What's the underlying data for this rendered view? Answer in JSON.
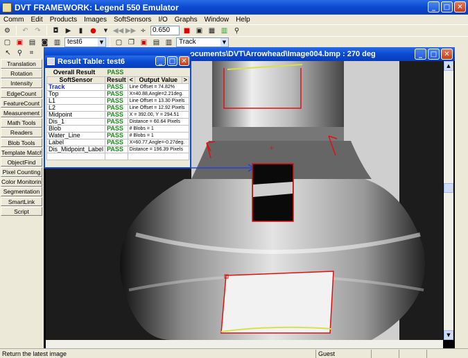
{
  "app": {
    "title": "DVT FRAMEWORK: Legend 550 Emulator"
  },
  "menu": [
    "Comm",
    "Edit",
    "Products",
    "Images",
    "SoftSensors",
    "I/O",
    "Graphs",
    "Window",
    "Help"
  ],
  "toolbar": {
    "threshold_value": "0.650",
    "product_select": "test6",
    "sensor_select": "Track"
  },
  "sidebar": {
    "buttons": [
      "Translation",
      "Rotation",
      "Intensity",
      "EdgeCount",
      "FeatureCount",
      "Measurement",
      "Math Tools",
      "Readers",
      "Blob Tools",
      "Template Match",
      "ObjectFind",
      "Pixel Counting",
      "Color Monitoring",
      "Segmentation",
      "SmartLink",
      "Script"
    ]
  },
  "image_window": {
    "title": "ocuments\\DVT\\Arrowhead\\Image004.bmp : 270 deg"
  },
  "result_table": {
    "title": "Result Table: test6",
    "overall_label": "Overall Result",
    "overall_value": "PASS",
    "col_sensor": "SoftSensor",
    "col_result": "Result",
    "col_prev": "<",
    "col_output": "Output Value",
    "col_next": ">",
    "rows": [
      {
        "name": "Track",
        "result": "PASS",
        "output": "Line Offset = 74.82%"
      },
      {
        "name": "Top",
        "result": "PASS",
        "output": "X=40.88,Angle=2.21deg."
      },
      {
        "name": "L1",
        "result": "PASS",
        "output": "Line Offset = 13.30 Pixels"
      },
      {
        "name": "L2",
        "result": "PASS",
        "output": "Line Offset = 12.92 Pixels"
      },
      {
        "name": "Midpoint",
        "result": "PASS",
        "output": "X = 392.00, Y = 294.51"
      },
      {
        "name": "Dis_1",
        "result": "PASS",
        "output": "Distance = 60.64 Pixels"
      },
      {
        "name": "Blob",
        "result": "PASS",
        "output": "# Blobs = 1"
      },
      {
        "name": "Water_Line",
        "result": "PASS",
        "output": "# Blobs = 1"
      },
      {
        "name": "Label",
        "result": "PASS",
        "output": "X=60.77,Angle=-0.27deg."
      },
      {
        "name": "Dis_Midpoint_Label",
        "result": "PASS",
        "output": "Distance = 196.39 Pixels"
      }
    ]
  },
  "status": {
    "message": "Return the latest image",
    "user": "Guest"
  },
  "colors": {
    "titlebar": "#0a4ad0",
    "pass": "#1a8a1a",
    "overlay": "#e01010",
    "arrow": "#2040e0"
  }
}
